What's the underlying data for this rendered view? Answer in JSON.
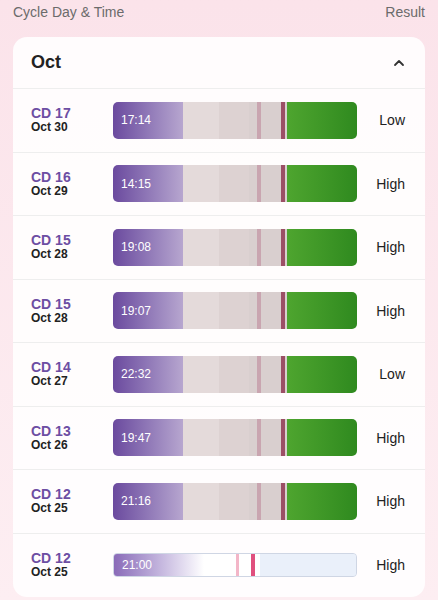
{
  "header": {
    "left": "Cycle Day & Time",
    "right": "Result"
  },
  "month": {
    "label": "Oct",
    "expanded": true
  },
  "rows": [
    {
      "cycle_day": "CD 17",
      "date": "Oct 30",
      "time": "17:14",
      "result": "Low",
      "kind": "photo"
    },
    {
      "cycle_day": "CD 16",
      "date": "Oct 29",
      "time": "14:15",
      "result": "High",
      "kind": "photo"
    },
    {
      "cycle_day": "CD 15",
      "date": "Oct 28",
      "time": "19:08",
      "result": "High",
      "kind": "photo"
    },
    {
      "cycle_day": "CD 15",
      "date": "Oct 28",
      "time": "19:07",
      "result": "High",
      "kind": "photo"
    },
    {
      "cycle_day": "CD 14",
      "date": "Oct 27",
      "time": "22:32",
      "result": "Low",
      "kind": "photo"
    },
    {
      "cycle_day": "CD 13",
      "date": "Oct 26",
      "time": "19:47",
      "result": "High",
      "kind": "photo"
    },
    {
      "cycle_day": "CD 12",
      "date": "Oct 25",
      "time": "21:16",
      "result": "High",
      "kind": "photo"
    },
    {
      "cycle_day": "CD 12",
      "date": "Oct 25",
      "time": "21:00",
      "result": "High",
      "kind": "digital"
    }
  ]
}
